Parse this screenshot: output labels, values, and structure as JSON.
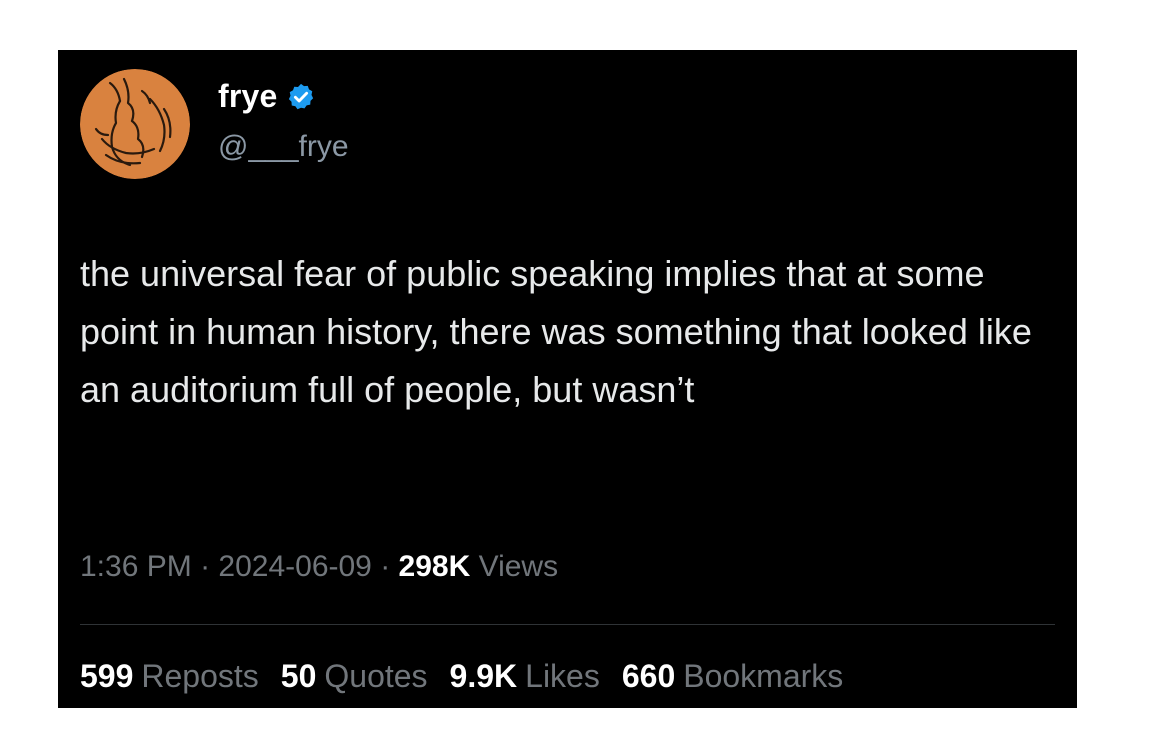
{
  "author": {
    "display_name": "frye",
    "handle": "@___frye",
    "verified": true,
    "avatar_icon": "avatar-drawing-icon",
    "verified_icon": "verified-badge-icon"
  },
  "tweet": {
    "text": "the universal fear of public speaking implies that at some point in human history, there was something that looked like an auditorium full of people, but wasn’t"
  },
  "meta": {
    "time": "1:36 PM",
    "date": "2024-06-09",
    "sep": "·",
    "views_count": "298K",
    "views_label": "Views"
  },
  "stats": [
    {
      "count": "599",
      "label": "Reposts"
    },
    {
      "count": "50",
      "label": "Quotes"
    },
    {
      "count": "9.9K",
      "label": "Likes"
    },
    {
      "count": "660",
      "label": "Bookmarks"
    }
  ],
  "colors": {
    "card_bg": "#000000",
    "text": "#e7e9ea",
    "muted": "#71767b",
    "verified_blue": "#1d9bf0",
    "avatar_orange": "#d9823f"
  }
}
